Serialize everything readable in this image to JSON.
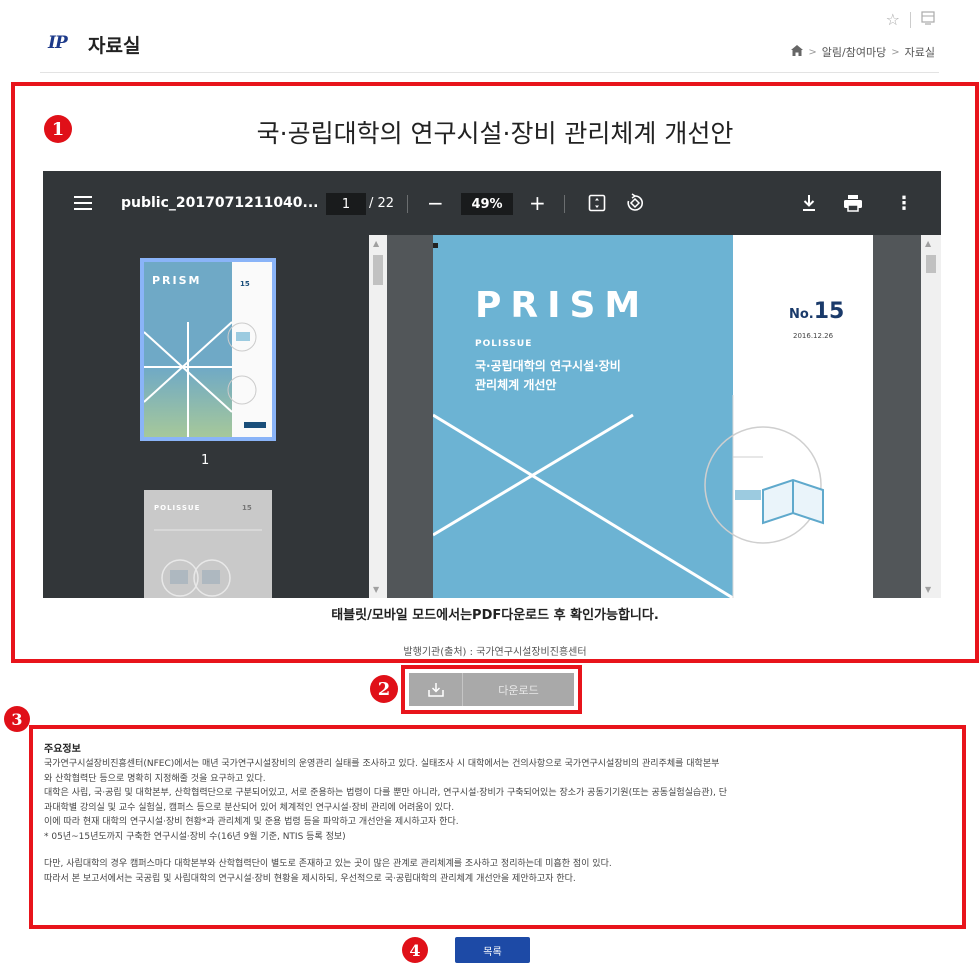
{
  "header": {
    "logo_text": "IP",
    "title": "자료실",
    "icons": [
      "star-icon",
      "print-icon"
    ],
    "breadcrumb": [
      "알림/참여마당",
      "자료실"
    ]
  },
  "markers": [
    "1",
    "2",
    "3",
    "4"
  ],
  "document": {
    "title": "국·공립대학의 연구시설·장비 관리체계 개선안",
    "viewer_note": "태블릿/모바일 모드에서는PDF다운로드 후 확인가능합니다.",
    "publisher": "발행기관(출처) : 국가연구시설장비진흥센터"
  },
  "pdf_viewer": {
    "filename": "public_2017071211040...",
    "current_page": "1",
    "total_pages": "/ 22",
    "zoom": "49%",
    "thumbnail_label": "1",
    "cover": {
      "brand": "PRISM",
      "series": "POLISSUE",
      "title_line1": "국·공립대학의 연구시설·장비",
      "title_line2": "관리체계 개선안",
      "issue_prefix": "No.",
      "issue_number": "15",
      "issue_date": "2016.12.26"
    },
    "colors": {
      "toolbar": "#323639",
      "cover": "#6cb3d3"
    }
  },
  "download": {
    "label": "다운로드"
  },
  "info": {
    "title": "주요정보",
    "lines": [
      "국가연구시설장비진흥센터(NFEC)에서는 매년 국가연구시설장비의 운영관리 실태를 조사하고 있다. 실태조사 시 대학에서는 건의사항으로 국가연구시설장비의 관리주체를 대학본부",
      "와 산학협력단 등으로 명확히 지정해줄 것을 요구하고 있다.",
      "대학은 사립, 국·공립 및 대학본부, 산학협력단으로 구분되어있고, 서로 준용하는 법령이 다를 뿐만 아니라, 연구시설·장비가 구축되어있는 장소가 공동기기원(또는 공동실험실습관), 단",
      "과대학별 강의실 및 교수 실험실, 캠퍼스 등으로 분산되어 있어 체계적인 연구시설·장비 관리에 어려움이 있다.",
      "이에 따라 현재 대학의 연구시설·장비 현황*과 관리체계 및 준용 법령 등을 파악하고 개선안을 제시하고자 한다.",
      "* 05년~15년도까지 구축한 연구시설·장비 수(16년 9월 기준, NTIS 등록 정보)"
    ],
    "lines2": [
      "다만, 사립대학의 경우 캠퍼스마다 대학본부와 산학협력단이 별도로 존재하고 있는 곳이 많은 관계로 관리체계를 조사하고 정리하는데 미흡한 점이 있다.",
      "따라서 본 보고서에서는 국공립 및 사립대학의 연구시설·장비 현황을 제시하되, 우선적으로 국·공립대학의 관리체계 개선안을 제안하고자 한다."
    ]
  },
  "list_button": {
    "label": "목록"
  }
}
